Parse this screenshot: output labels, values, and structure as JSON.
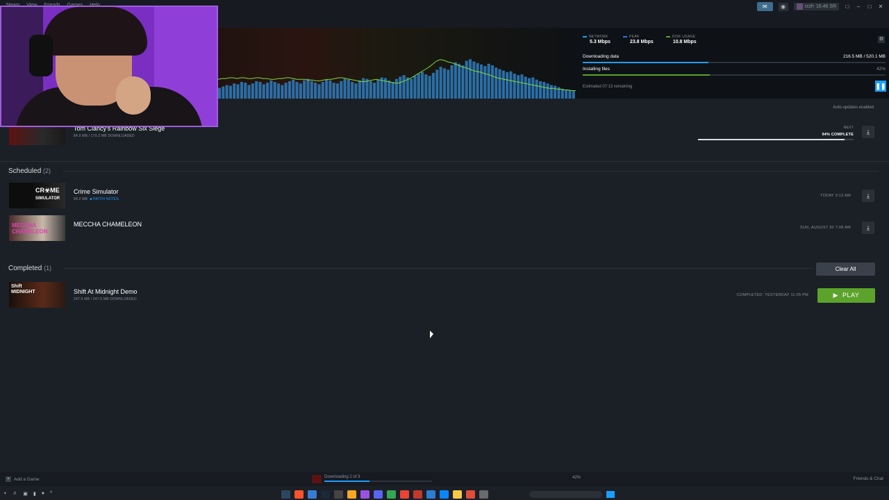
{
  "menu": [
    "Steam",
    "View",
    "Friends",
    "Games",
    "Help"
  ],
  "topbar": {
    "user": "rzzh",
    "points": "16.46 SR"
  },
  "stats": {
    "network_label": "NETWORK",
    "network_value": "5.3 Mbps",
    "peak_label": "PEAK",
    "peak_value": "23.8 Mbps",
    "disk_label": "DISK USAGE",
    "disk_value": "10.8 Mbps",
    "network_color": "#1a9fff",
    "peak_color": "#2d73ff",
    "disk_color": "#5ba32b"
  },
  "progress": {
    "downloading_label": "Downloading data",
    "downloading_amount": "216.5 MB / 520.1 MB",
    "downloading_fraction": 0.416,
    "installing_label": "Installing files",
    "installing_pct": "42%",
    "installing_fraction": 0.42,
    "estimated": "Estimated 07:13 remaining"
  },
  "auto_updates": "Auto-updates enabled",
  "current": {
    "title": "Tom Clancy's Rainbow Six Siege",
    "sub": "84.9 MB / 170.2 MB DOWNLOADED",
    "next_label": "NEXT",
    "complete": "94% COMPLETE",
    "complete_fraction": 0.94
  },
  "scheduled": {
    "label": "Scheduled",
    "count": "(2)",
    "items": [
      {
        "title": "Crime Simulator",
        "size": "90.2 MB",
        "patch": "PATCH NOTES",
        "time": "TODAY 3:13 AM"
      },
      {
        "title": "MECCHA CHAMELEON",
        "size": "",
        "patch": "",
        "time": "SUN, AUGUST 30 7:08 AM"
      }
    ]
  },
  "completed": {
    "label": "Completed",
    "count": "(1)",
    "clear_all": "Clear All",
    "items": [
      {
        "title": "Shift At Midnight Demo",
        "sub": "247.5 MB / 247.5 MB DOWNLOADED",
        "time": "COMPLETED: YESTERDAY 11:05 PM",
        "play": "PLAY"
      }
    ]
  },
  "statusbar": {
    "add_game": "Add a Game",
    "downloading": "Downloading 2 of 3",
    "pct": "42%",
    "fraction": 0.42,
    "friends": "Friends & Chat"
  },
  "graph": {
    "bars": [
      14,
      16,
      18,
      17,
      20,
      19,
      22,
      21,
      18,
      20,
      23,
      22,
      19,
      21,
      24,
      22,
      20,
      18,
      21,
      23,
      25,
      22,
      20,
      24,
      26,
      23,
      21,
      19,
      22,
      25,
      24,
      21,
      20,
      23,
      26,
      25,
      22,
      20,
      24,
      27,
      26,
      23,
      21,
      25,
      28,
      27,
      24,
      22,
      26,
      29,
      31,
      28,
      26,
      30,
      33,
      35,
      32,
      30,
      34,
      38,
      42,
      40,
      38,
      44,
      48,
      46,
      44,
      50,
      52,
      49,
      47,
      45,
      43,
      46,
      44,
      41,
      39,
      37,
      35,
      36,
      33,
      31,
      32,
      29,
      27,
      28,
      25,
      23,
      22,
      20,
      18,
      17,
      15,
      13,
      12,
      11,
      10
    ],
    "line": [
      20,
      21,
      21,
      22,
      22,
      21,
      22,
      22,
      21,
      21,
      22,
      22,
      21,
      21,
      20,
      20,
      21,
      21,
      22,
      22,
      21,
      20,
      20,
      20,
      19,
      19,
      18,
      18,
      19,
      20,
      20,
      21,
      22,
      22,
      21,
      20,
      19,
      18,
      17,
      17,
      18,
      19,
      20,
      19,
      18,
      17,
      16,
      15,
      15,
      17,
      19,
      21,
      24,
      27,
      30,
      33,
      36,
      40,
      44,
      46,
      45,
      43,
      42,
      40,
      38,
      36,
      35,
      33,
      31,
      30,
      29,
      27,
      26,
      24,
      22,
      21,
      20,
      19,
      18,
      17,
      16,
      15,
      14,
      13,
      12,
      11,
      10,
      9,
      8,
      8,
      7,
      7,
      6,
      6,
      5,
      5
    ]
  }
}
